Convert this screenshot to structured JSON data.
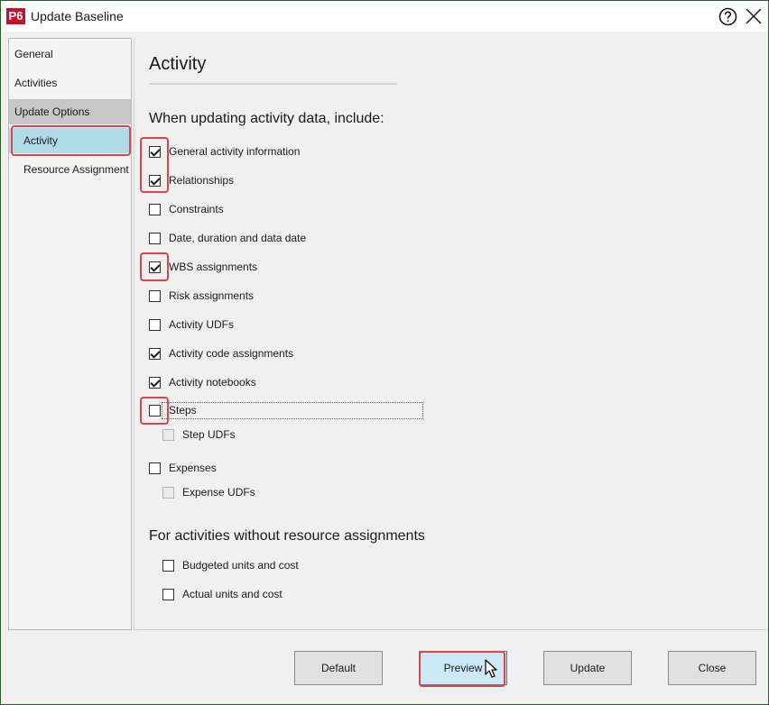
{
  "window": {
    "app_logo": "P6",
    "title": "Update Baseline"
  },
  "sidebar": {
    "items": [
      {
        "label": "General"
      },
      {
        "label": "Activities"
      },
      {
        "label": "Update Options"
      },
      {
        "label": "Activity"
      },
      {
        "label": "Resource Assignment"
      }
    ],
    "selected": "Activity"
  },
  "main": {
    "section_title": "Activity",
    "include_heading": "When updating activity data, include:",
    "options": [
      {
        "label": "General activity information",
        "checked": true
      },
      {
        "label": "Relationships",
        "checked": true
      },
      {
        "label": "Constraints",
        "checked": false
      },
      {
        "label": "Date, duration and data date",
        "checked": false
      },
      {
        "label": "WBS assignments",
        "checked": true
      },
      {
        "label": "Risk assignments",
        "checked": false
      },
      {
        "label": "Activity UDFs",
        "checked": false
      },
      {
        "label": "Activity code assignments",
        "checked": true
      },
      {
        "label": "Activity notebooks",
        "checked": true
      },
      {
        "label": "Steps",
        "checked": false
      },
      {
        "label": "Step UDFs",
        "checked": false,
        "disabled": true
      },
      {
        "label": "Expenses",
        "checked": false
      },
      {
        "label": "Expense UDFs",
        "checked": false,
        "disabled": true
      }
    ],
    "no_resource_heading": "For activities without resource assignments",
    "no_resource_options": [
      {
        "label": "Budgeted units and cost",
        "checked": false
      },
      {
        "label": "Actual units and cost",
        "checked": false
      }
    ]
  },
  "footer": {
    "default_label": "Default",
    "preview_label": "Preview",
    "update_label": "Update",
    "close_label": "Close"
  },
  "colors": {
    "highlight": "#e0434a",
    "selected_nav": "#b2dbe9",
    "primary_button": "#cde8f7",
    "logo": "#c8102e"
  }
}
